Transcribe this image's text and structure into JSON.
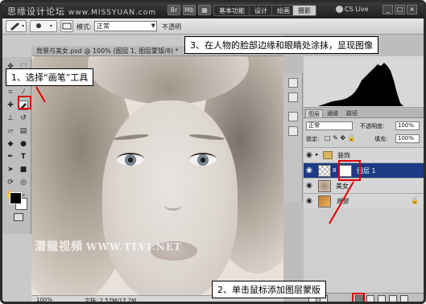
{
  "app": {
    "watermark": "思缘设计论坛",
    "watermark_url": "www.MISSYUAN.com",
    "cs_live": "CS Live",
    "workspace": [
      {
        "label": "基本功能",
        "active": false
      },
      {
        "label": "设计",
        "active": false
      },
      {
        "label": "绘画",
        "active": false
      },
      {
        "label": "摄影",
        "active": true
      }
    ],
    "window_buttons": [
      "_",
      "□",
      "×"
    ]
  },
  "options_bar": {
    "mode_label": "模式:",
    "mode_value": "正常",
    "opacity_label": "不透明"
  },
  "document": {
    "tab_title": "背景与美女.psd @ 100% (图层 1, 图层蒙版/8) *",
    "zoom": "100%",
    "doc_info": "文档: 2.57M/17.2M",
    "canvas_watermark": "潜龍视頻",
    "canvas_watermark_url": "WWW.TLVI.NET"
  },
  "tools": {
    "icons": [
      "move-icon",
      "marquee-icon",
      "lasso-icon",
      "magic-wand-icon",
      "crop-icon",
      "eyedropper-icon",
      "healing-icon",
      "brush-icon",
      "clone-stamp-icon",
      "history-brush-icon",
      "eraser-icon",
      "gradient-icon",
      "blur-icon",
      "dodge-icon",
      "pen-icon",
      "type-icon",
      "path-select-icon",
      "shape-icon",
      "3d-rotate-icon",
      "3d-orbit-icon",
      "hand-icon",
      "zoom-icon"
    ]
  },
  "layers_panel": {
    "tabs": [
      "图层",
      "通道",
      "路径"
    ],
    "blend_mode": "正常",
    "opacity_label": "不透明度:",
    "opacity_value": "100%",
    "lock_label": "锁定:",
    "fill_label": "填充:",
    "fill_value": "100%",
    "layers": [
      {
        "name": "装饰",
        "type": "group",
        "selected": false
      },
      {
        "name": "图层 1",
        "type": "layer-with-mask",
        "selected": true
      },
      {
        "name": "美女",
        "type": "layer",
        "selected": false
      },
      {
        "name": "背景",
        "type": "layer",
        "selected": false
      }
    ]
  },
  "annotations": {
    "step1": "1、选择“画笔”工具",
    "step2": "2、单击鼠标添加图层蒙版",
    "step3": "3、在人物的脸部边缘和眼睛处涂抹，显现图像"
  },
  "colors": {
    "accent_red": "#e00000",
    "selected_layer": "#1c3b86"
  }
}
